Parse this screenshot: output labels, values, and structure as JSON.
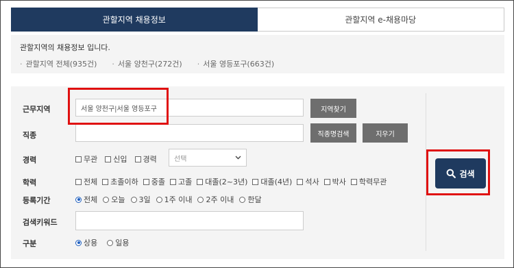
{
  "tabs": [
    {
      "label": "관할지역 채용정보",
      "active": true
    },
    {
      "label": "관할지역 e-채용마당",
      "active": false
    }
  ],
  "info": {
    "description": "관할지역의 채용정보 입니다.",
    "counts": [
      "관할지역 전체(935건)",
      "서울 양천구(272건)",
      "서울 영등포구(663건)"
    ]
  },
  "form": {
    "region": {
      "label": "근무지역",
      "value": "서울 양천구|서울 영등포구",
      "button": "지역찾기"
    },
    "job": {
      "label": "직종",
      "value": "",
      "search_button": "직종명검색",
      "clear_button": "지우기"
    },
    "career": {
      "label": "경력",
      "options": [
        "무관",
        "신입",
        "경력"
      ],
      "select_placeholder": "선택"
    },
    "education": {
      "label": "학력",
      "options": [
        "전체",
        "초졸이하",
        "중졸",
        "고졸",
        "대졸(2~3년)",
        "대졸(4년)",
        "석사",
        "박사",
        "학력무관"
      ]
    },
    "period": {
      "label": "등록기간",
      "options": [
        "전체",
        "오늘",
        "3일",
        "1주 이내",
        "2주 이내",
        "한달"
      ],
      "selected": "전체"
    },
    "keyword": {
      "label": "검색키워드",
      "value": ""
    },
    "type": {
      "label": "구분",
      "options": [
        "상용",
        "일용"
      ],
      "selected": "상용"
    },
    "search_button": "검색"
  },
  "colors": {
    "primary": "#1f3a5f",
    "highlight": "#e01010",
    "gray_button": "#6e6e6e"
  },
  "icons": {
    "search": "magnifier-icon",
    "dropdown": "chevron-down-icon"
  }
}
